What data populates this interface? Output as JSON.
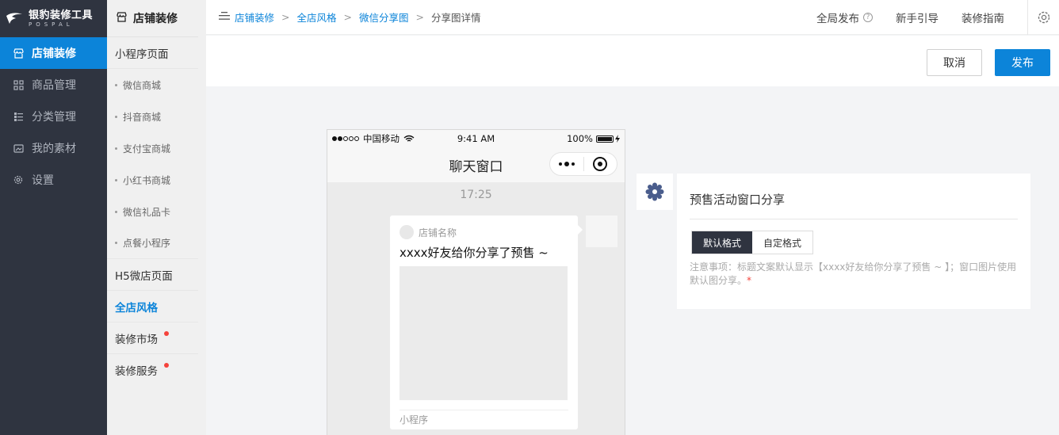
{
  "brand": {
    "name": "银豹装修工具",
    "sub": "POSPAL"
  },
  "sidebar": {
    "items": [
      {
        "label": "店铺装修",
        "icon": "store-icon",
        "active": true
      },
      {
        "label": "商品管理",
        "icon": "grid-icon"
      },
      {
        "label": "分类管理",
        "icon": "list-icon"
      },
      {
        "label": "我的素材",
        "icon": "image-icon"
      },
      {
        "label": "设置",
        "icon": "gear-icon"
      }
    ]
  },
  "submenu": {
    "title": "店铺装修",
    "group_miniapp": "小程序页面",
    "miniapp_items": [
      "微信商城",
      "抖音商城",
      "支付宝商城",
      "小红书商城",
      "微信礼品卡",
      "点餐小程序"
    ],
    "group_h5": "H5微店页面",
    "group_style": "全店风格",
    "group_market": "装修市场",
    "group_service": "装修服务"
  },
  "breadcrumb": {
    "items": [
      "店铺装修",
      "全店风格",
      "微信分享图"
    ],
    "current": "分享图详情",
    "separator": ">"
  },
  "topbar": {
    "publish_all": "全局发布",
    "help_mark": "?",
    "guide": "新手引导",
    "manual": "装修指南"
  },
  "actions": {
    "cancel": "取消",
    "publish": "发布"
  },
  "phone": {
    "carrier": "中国移动",
    "time": "9:41 AM",
    "battery": "100%",
    "nav_title": "聊天窗口",
    "chat_time": "17:25",
    "store_name": "店铺名称",
    "message_title": "xxxx好友给你分享了预售 ~",
    "footer": "小程序"
  },
  "panel": {
    "title": "预售活动窗口分享",
    "tab_default": "默认格式",
    "tab_custom": "自定格式",
    "note": "注意事项：标题文案默认显示【xxxx好友给你分享了预售 ~ 】；窗口图片使用默认图分享。",
    "star": "*"
  },
  "colors": {
    "accent": "#0c84d9",
    "sidebar_bg": "#2f3440",
    "badge": "#f5433b"
  }
}
